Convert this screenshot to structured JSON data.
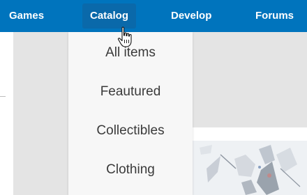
{
  "nav": {
    "items": [
      {
        "label": "Games"
      },
      {
        "label": "Catalog"
      },
      {
        "label": "Develop"
      },
      {
        "label": "Forums"
      }
    ]
  },
  "catalog_menu": {
    "items": [
      {
        "label": "All items"
      },
      {
        "label": "Feautured"
      },
      {
        "label": "Collectibles"
      },
      {
        "label": "Clothing"
      }
    ]
  },
  "colors": {
    "navbar": "#0074bd",
    "active_tab": "#0a69aa",
    "dropdown_bg": "#f7f7f7",
    "page_bg": "#e4e4e4"
  },
  "icons": {
    "cursor": "hand-pointer-icon"
  }
}
